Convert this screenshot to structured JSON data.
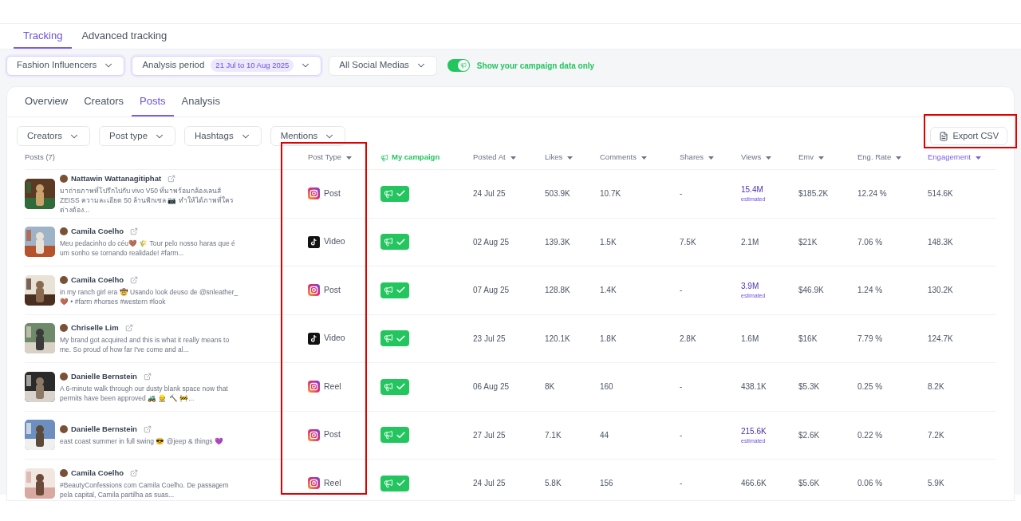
{
  "top_tabs": [
    {
      "label": "Tracking",
      "selected": true
    },
    {
      "label": "Advanced tracking",
      "selected": false
    }
  ],
  "filters": {
    "group": "Fashion Influencers",
    "period_label": "Analysis period",
    "period_value": "21 Jul to 10 Aug 2025",
    "social": "All Social Medias",
    "campaign_toggle": {
      "on": true,
      "label": "Show your campaign data only"
    }
  },
  "section_tabs": [
    {
      "label": "Overview",
      "selected": false
    },
    {
      "label": "Creators",
      "selected": false
    },
    {
      "label": "Posts",
      "selected": true
    },
    {
      "label": "Analysis",
      "selected": false
    }
  ],
  "table_filters": [
    "Creators",
    "Post type",
    "Hashtags",
    "Mentions"
  ],
  "export_button": "Export CSV",
  "columns": [
    {
      "label": "Posts (7)",
      "kind": "plain",
      "sortable": false,
      "selected": false
    },
    {
      "label": "Post Type",
      "kind": "plain",
      "sortable": true,
      "selected": false
    },
    {
      "label": "My campaign",
      "kind": "campaign",
      "sortable": false,
      "selected": false
    },
    {
      "label": "Posted At",
      "kind": "plain",
      "sortable": true,
      "selected": false
    },
    {
      "label": "Likes",
      "kind": "plain",
      "sortable": true,
      "selected": false
    },
    {
      "label": "Comments",
      "kind": "plain",
      "sortable": true,
      "selected": false
    },
    {
      "label": "Shares",
      "kind": "plain",
      "sortable": true,
      "selected": false
    },
    {
      "label": "Views",
      "kind": "plain",
      "sortable": true,
      "selected": false
    },
    {
      "label": "Emv",
      "kind": "plain",
      "sortable": true,
      "selected": false
    },
    {
      "label": "Eng. Rate",
      "kind": "plain",
      "sortable": true,
      "selected": false
    },
    {
      "label": "Engagement",
      "kind": "plain",
      "sortable": true,
      "selected": true
    }
  ],
  "rows": [
    {
      "creator": "Nattawin Wattanagitiphat",
      "caption": "มาถ่ายภาพที่โปรึกไปกับ vivo V50 ที่มาพร้อมกล้องเลนส์ ZEISS ความละเอียด 50 ล้านพิกเซล 📷 ทำให้ได้ภาพที่ใครต่างต้อง...",
      "kind": "instagram",
      "post_type": "Post",
      "campaign": true,
      "posted_at": "24 Jul 25",
      "likes": "503.9K",
      "comments": "10.7K",
      "shares": "-",
      "views": "15.4M",
      "views_note": "estimated",
      "emv": "$185.2K",
      "eng_rate": "12.24 %",
      "engagement": "514.6K"
    },
    {
      "creator": "Camila Coelho",
      "caption": "Meu pedacinho do céu🤎 🌾 Tour pelo nosso haras que é um sonho se tornando realidade! #farm...",
      "kind": "tiktok",
      "post_type": "Video",
      "campaign": true,
      "posted_at": "02 Aug 25",
      "likes": "139.3K",
      "comments": "1.5K",
      "shares": "7.5K",
      "views": "2.1M",
      "emv": "$21K",
      "eng_rate": "7.06 %",
      "engagement": "148.3K"
    },
    {
      "creator": "Camila Coelho",
      "caption": "in my ranch girl era 🤠 Usando look deuso de @snleather_ 🤎 • #farm #horses #western #look",
      "kind": "instagram",
      "post_type": "Post",
      "campaign": true,
      "posted_at": "07 Aug 25",
      "likes": "128.8K",
      "comments": "1.4K",
      "shares": "-",
      "views": "3.9M",
      "views_note": "estimated",
      "emv": "$46.9K",
      "eng_rate": "1.24 %",
      "engagement": "130.2K"
    },
    {
      "creator": "Chriselle Lim",
      "caption": "My brand got acquired and this is what it really means to me. So proud of how far I've come and al...",
      "kind": "tiktok",
      "post_type": "Video",
      "campaign": true,
      "posted_at": "23 Jul 25",
      "likes": "120.1K",
      "comments": "1.8K",
      "shares": "2.8K",
      "views": "1.6M",
      "emv": "$16K",
      "eng_rate": "7.79 %",
      "engagement": "124.7K"
    },
    {
      "creator": "Danielle Bernstein",
      "caption": "A 6-minute walk through our dusty blank space now that permits have been approved 🚜 👷 🔨 🚧...",
      "kind": "instagram",
      "post_type": "Reel",
      "campaign": true,
      "posted_at": "06 Aug 25",
      "likes": "8K",
      "comments": "160",
      "shares": "-",
      "views": "438.1K",
      "emv": "$5.3K",
      "eng_rate": "0.25 %",
      "engagement": "8.2K"
    },
    {
      "creator": "Danielle Bernstein",
      "caption": "east coast summer in full swing 😎 @jeep & things 💜",
      "kind": "instagram",
      "post_type": "Post",
      "campaign": true,
      "posted_at": "27 Jul 25",
      "likes": "7.1K",
      "comments": "44",
      "shares": "-",
      "views": "215.6K",
      "views_note": "estimated",
      "emv": "$2.6K",
      "eng_rate": "0.22 %",
      "engagement": "7.2K"
    },
    {
      "creator": "Camila Coelho",
      "caption": "#BeautyConfessions com Camila Coelho. De passagem pela capital, Camila partilha as suas...",
      "kind": "instagram",
      "post_type": "Reel",
      "campaign": true,
      "posted_at": "24 Jul 25",
      "likes": "5.8K",
      "comments": "156",
      "shares": "-",
      "views": "466.6K",
      "emv": "$5.6K",
      "eng_rate": "0.06 %",
      "engagement": "5.9K"
    }
  ]
}
